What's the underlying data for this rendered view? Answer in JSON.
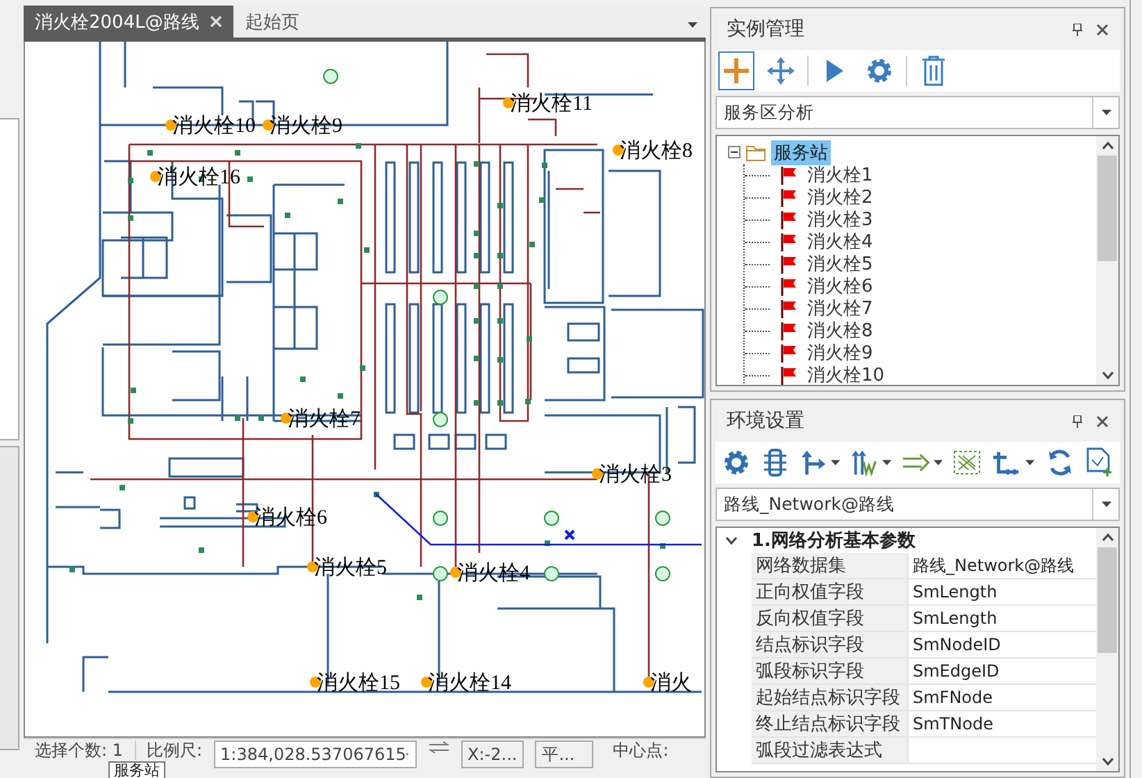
{
  "document_tabs": [
    {
      "label": "消火栓2004L@路线",
      "selected": true,
      "closable": true
    },
    {
      "label": "起始页",
      "selected": false,
      "closable": false
    }
  ],
  "map": {
    "labels": [
      {
        "text": "消火栓11"
      },
      {
        "text": "消火栓10"
      },
      {
        "text": "消火栓9"
      },
      {
        "text": "消火栓8"
      },
      {
        "text": "消火栓16"
      },
      {
        "text": "消火栓7"
      },
      {
        "text": "消火栓3"
      },
      {
        "text": "消火栓6"
      },
      {
        "text": "消火栓5"
      },
      {
        "text": "消火栓4"
      },
      {
        "text": "消火栓15"
      },
      {
        "text": "消火栓14"
      },
      {
        "text": "消火"
      }
    ]
  },
  "status_bar": {
    "selection": "选择个数: 1",
    "scale_label": "比例尺:",
    "scale_value": "1:384,028.537067615",
    "x_field": "X:-2...",
    "mode_field": "平...",
    "center_label": "中心点:"
  },
  "tooltip": "服务站",
  "instance_panel": {
    "title": "实例管理",
    "toolbar": [
      [
        {
          "kind": "add",
          "selected": true
        },
        {
          "kind": "move",
          "selected": false
        }
      ],
      [
        {
          "kind": "run",
          "selected": false
        },
        {
          "kind": "settings",
          "selected": false
        }
      ],
      [
        {
          "kind": "delete",
          "selected": false
        }
      ]
    ],
    "analysis_type": "服务区分析",
    "tree": {
      "label": "服务站",
      "selected": true,
      "expanded": true,
      "children": [
        {
          "label": "消火栓1"
        },
        {
          "label": "消火栓2"
        },
        {
          "label": "消火栓3"
        },
        {
          "label": "消火栓4"
        },
        {
          "label": "消火栓5"
        },
        {
          "label": "消火栓6"
        },
        {
          "label": "消火栓7"
        },
        {
          "label": "消火栓8"
        },
        {
          "label": "消火栓9"
        },
        {
          "label": "消火栓10"
        }
      ]
    }
  },
  "environment_panel": {
    "title": "环境设置",
    "toolbar": [
      {
        "kind": "settings",
        "dropdown": false
      },
      {
        "kind": "list",
        "dropdown": false
      },
      {
        "kind": "branch",
        "dropdown": true
      },
      {
        "kind": "weight",
        "dropdown": true
      },
      {
        "kind": "direction",
        "dropdown": true
      },
      {
        "kind": "barrier",
        "dropdown": false
      },
      {
        "kind": "axis",
        "dropdown": true
      },
      {
        "kind": "refresh",
        "dropdown": false
      },
      {
        "kind": "export",
        "dropdown": false
      }
    ],
    "dataset": "路线_Network@路线",
    "properties": {
      "category": "1.网络分析基本参数",
      "expanded": true,
      "rows": [
        {
          "name": "网络数据集",
          "value": "路线_Network@路线"
        },
        {
          "name": "正向权值字段",
          "value": "SmLength"
        },
        {
          "name": "反向权值字段",
          "value": "SmLength"
        },
        {
          "name": "结点标识字段",
          "value": "SmNodeID"
        },
        {
          "name": "弧段标识字段",
          "value": "SmEdgeID"
        },
        {
          "name": "起始结点标识字段",
          "value": "SmFNode"
        },
        {
          "name": "终止结点标识字段",
          "value": "SmTNode"
        },
        {
          "name": "弧段过滤表达式"
        }
      ]
    }
  }
}
